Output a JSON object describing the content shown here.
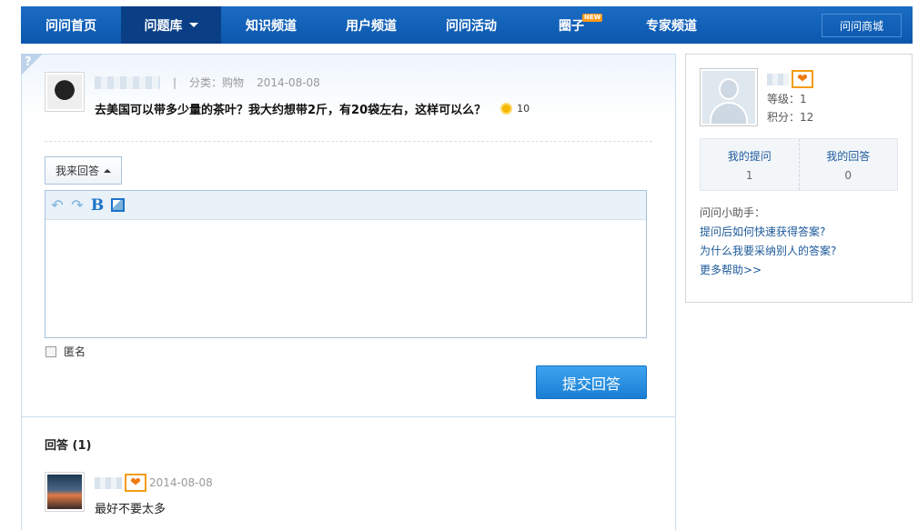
{
  "nav": {
    "items": [
      {
        "label": "问问首页"
      },
      {
        "label": "问题库"
      },
      {
        "label": "知识频道"
      },
      {
        "label": "用户频道"
      },
      {
        "label": "问问活动"
      },
      {
        "label": "圈子"
      },
      {
        "label": "专家频道"
      }
    ],
    "new_badge": "NEW",
    "shop": "问问商城"
  },
  "question": {
    "category": "分类：购物",
    "date": "2014-08-08",
    "title": "去美国可以带多少量的茶叶？我大约想带2斤，有20袋左右，这样可以么？",
    "reward": "10",
    "answer_toggle": "我来回答",
    "anonymous_label": "匿名",
    "submit": "提交回答"
  },
  "answers": {
    "title": "回答 (1)",
    "items": [
      {
        "date": "2014-08-08",
        "text": "最好不要太多"
      }
    ]
  },
  "sidebar": {
    "level": "等级：1",
    "points": "积分：12",
    "stats": [
      {
        "label": "我的提问",
        "value": "1"
      },
      {
        "label": "我的回答",
        "value": "0"
      }
    ],
    "helper_title": "问问小助手：",
    "links": [
      "提问后如何快速获得答案?",
      "为什么我要采纳别人的答案?",
      "更多帮助>>"
    ]
  },
  "colors": {
    "nav_bg": "#0b57ad",
    "nav_active": "#0a3f86",
    "link": "#1d5a9a",
    "submit": "#1a7fd4",
    "badge": "#f39c12"
  }
}
